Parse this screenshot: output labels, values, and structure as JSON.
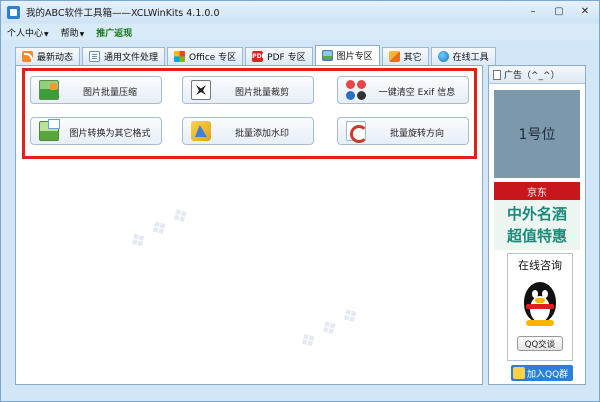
{
  "window": {
    "title": "我的ABC软件工具箱——XCLWinKits  4.1.0.0",
    "controls": {
      "minimize": "–",
      "maximize": "▢",
      "close": "✕"
    }
  },
  "menu": [
    {
      "label": "个人中心",
      "has_dropdown": true
    },
    {
      "label": "帮助",
      "has_dropdown": true
    },
    {
      "label": "推广返现",
      "has_dropdown": false,
      "color": "#1a7a1a"
    }
  ],
  "tabs": [
    {
      "label": "最新动态",
      "icon": "rss-icon",
      "active": false
    },
    {
      "label": "通用文件处理",
      "icon": "document-icon",
      "active": false
    },
    {
      "label": "Office 专区",
      "icon": "office-icon",
      "active": false
    },
    {
      "label": "PDF 专区",
      "icon": "pdf-icon",
      "active": false
    },
    {
      "label": "图片专区",
      "icon": "image-icon",
      "active": true
    },
    {
      "label": "其它",
      "icon": "other-icon",
      "active": false
    },
    {
      "label": "在线工具",
      "icon": "globe-icon",
      "active": false
    }
  ],
  "features": [
    {
      "label": "图片批量压缩",
      "icon": "image-compress-icon"
    },
    {
      "label": "图片批量裁剪",
      "icon": "crop-icon"
    },
    {
      "label": "一键清空 Exif 信息",
      "icon": "exif-clear-icon"
    },
    {
      "label": "图片转换为其它格式",
      "icon": "image-convert-icon"
    },
    {
      "label": "批量添加水印",
      "icon": "watermark-icon"
    },
    {
      "label": "批量旋转方向",
      "icon": "rotate-icon"
    }
  ],
  "highlight_color": "#e2201b",
  "sidebar": {
    "header": "广告（^_^）",
    "ad_slot": "1号位",
    "jd_label": "京东",
    "wine_line1": "中外名酒",
    "wine_line2": "超值特惠",
    "qq_title": "在线咨询",
    "qq_button": "QQ交谈",
    "qq_group": "加入QQ群"
  }
}
